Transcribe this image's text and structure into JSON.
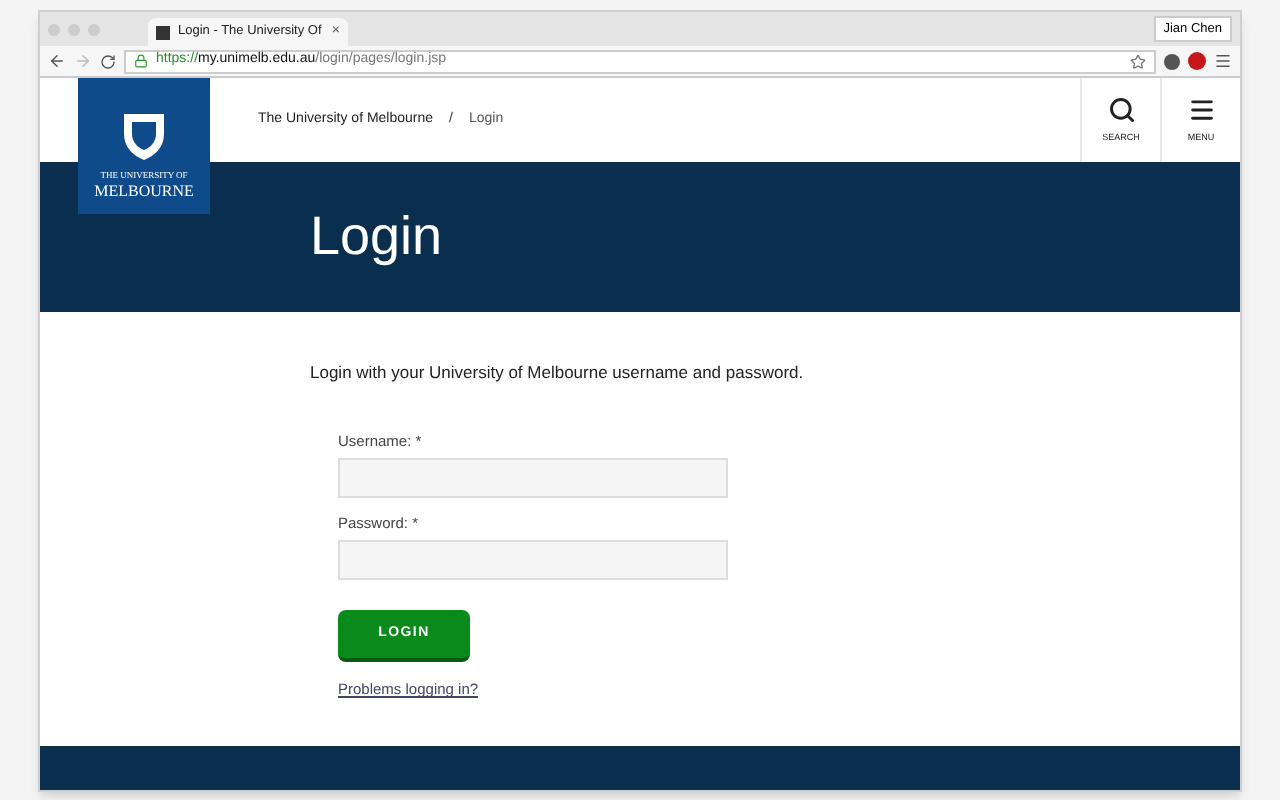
{
  "browser": {
    "tab_title": "Login - The University Of",
    "tab_close": "×",
    "profile": "Jian Chen",
    "url_scheme": "https://",
    "url_host": "my.unimelb.edu.au",
    "url_path": "/login/pages/login.jsp"
  },
  "header": {
    "logo_lines": [
      "THE UNIVERSITY OF",
      "MELBOURNE"
    ],
    "breadcrumbs": [
      "The University of Melbourne",
      "Login"
    ],
    "separator": "/",
    "actions": [
      {
        "kind": "search",
        "label": "SEARCH"
      },
      {
        "kind": "menu",
        "label": "MENU"
      }
    ]
  },
  "banner": {
    "title": "Login"
  },
  "form": {
    "intro": "Login with your University of Melbourne username and password.",
    "fields": [
      {
        "label": "Username: *"
      },
      {
        "label": "Password: *"
      }
    ],
    "submit": "LOGIN",
    "help_link": "Problems logging in?"
  }
}
